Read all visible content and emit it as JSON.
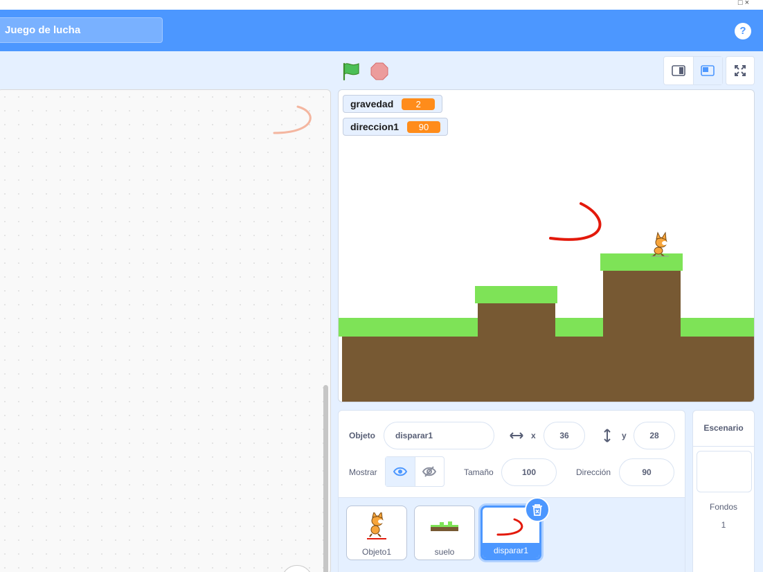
{
  "window": {
    "controls": "□  ×"
  },
  "menu": {
    "project_title": "Juego de lucha",
    "help_label": "?"
  },
  "controls": {
    "flag": "green-flag-icon",
    "stop": "stop-icon"
  },
  "monitors": [
    {
      "label": "gravedad",
      "value": "2"
    },
    {
      "label": "direccion1",
      "value": "90"
    }
  ],
  "sprite_info": {
    "object_label": "Objeto",
    "sprite_name": "disparar1",
    "x_label": "x",
    "x_value": "36",
    "y_label": "y",
    "y_value": "28",
    "show_label": "Mostrar",
    "size_label": "Tamaño",
    "size_value": "100",
    "direction_label": "Dirección",
    "direction_value": "90"
  },
  "sprites": [
    {
      "name": "Objeto1",
      "selected": false
    },
    {
      "name": "suelo",
      "selected": false
    },
    {
      "name": "disparar1",
      "selected": true
    }
  ],
  "stage_pane": {
    "title": "Escenario",
    "backdrops_label": "Fondos",
    "backdrops_count": "1"
  },
  "colors": {
    "menu_blue": "#4c97ff",
    "ground_green": "#7ee357",
    "ground_brown": "#775933",
    "monitor_orange": "#ff8c1a",
    "projectile_red": "#e3190b"
  }
}
